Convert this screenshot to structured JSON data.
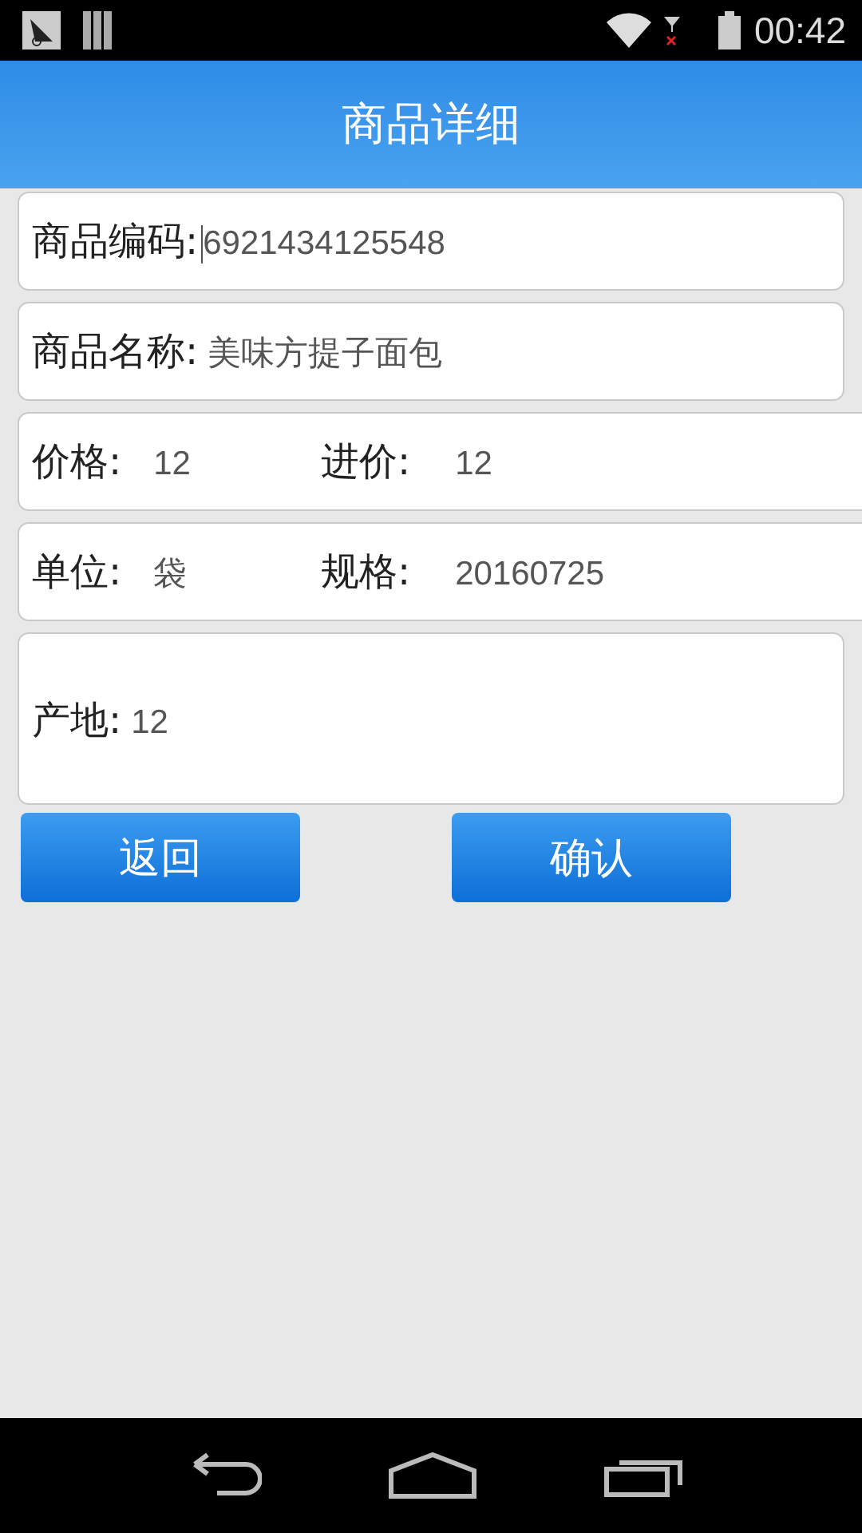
{
  "status_bar": {
    "time": "00:42"
  },
  "header": {
    "title": "商品详细"
  },
  "cards": [
    {
      "kind": "single",
      "fields": [
        {
          "label": "商品编码:",
          "value": "6921434125548",
          "focused": true
        }
      ]
    },
    {
      "kind": "single",
      "fields": [
        {
          "label": "商品名称:",
          "value": "美味方提子面包",
          "focused": false
        }
      ]
    },
    {
      "kind": "pair",
      "fields": [
        {
          "label": "价格:",
          "value": "12",
          "focused": false
        },
        {
          "label": "进价:",
          "value": "12",
          "focused": false
        }
      ]
    },
    {
      "kind": "pair",
      "fields": [
        {
          "label": "单位:",
          "value": "袋",
          "focused": false
        },
        {
          "label": "规格:",
          "value": "20160725",
          "focused": false
        }
      ]
    },
    {
      "kind": "tall",
      "fields": [
        {
          "label": "产地:",
          "value": "12",
          "focused": false
        }
      ]
    }
  ],
  "buttons": [
    "返回",
    "确认"
  ]
}
